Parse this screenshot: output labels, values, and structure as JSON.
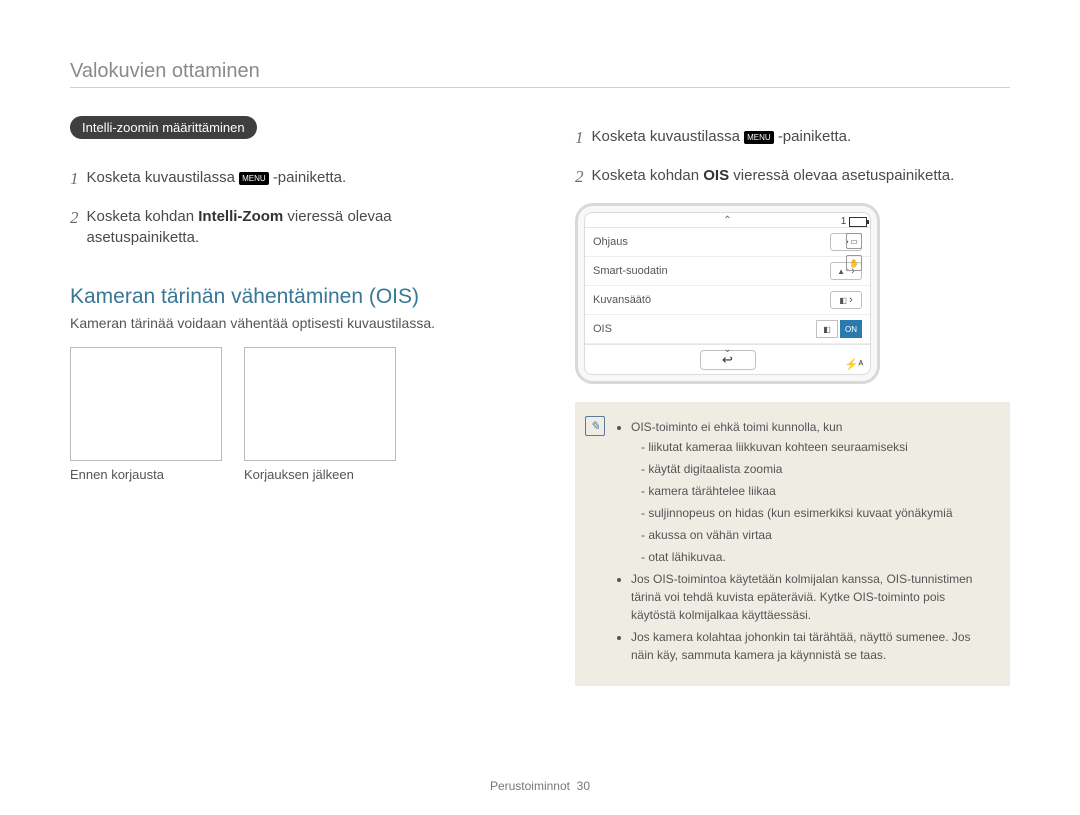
{
  "header": {
    "section_title": "Valokuvien ottaminen"
  },
  "left": {
    "pill": "Intelli-zoomin määrittäminen",
    "step1_prefix": "Kosketa kuvaustilassa ",
    "step1_badge": "MENU",
    "step1_suffix": "-painiketta.",
    "step2_prefix": "Kosketa kohdan ",
    "step2_bold": "Intelli-Zoom",
    "step2_suffix": " vieressä olevaa asetuspainiketta.",
    "heading": "Kameran tärinän vähentäminen (OIS)",
    "subtext": "Kameran tärinää voidaan vähentää optisesti kuvaustilassa.",
    "thumb1_label": "Ennen korjausta",
    "thumb2_label": "Korjauksen jälkeen"
  },
  "right": {
    "step1_prefix": "Kosketa kuvaustilassa ",
    "step1_badge": "MENU",
    "step1_suffix": "-painiketta.",
    "step2_prefix": "Kosketa kohdan ",
    "step2_bold": "OIS",
    "step2_suffix": " vieressä olevaa asetuspainiketta.",
    "screen": {
      "shots": "1",
      "rows": [
        {
          "label": "Ohjaus",
          "control": "chev",
          "icon": ""
        },
        {
          "label": "Smart-suodatin",
          "control": "chev",
          "icon": "▲⁺"
        },
        {
          "label": "Kuvansäätö",
          "control": "chev",
          "icon": "◧"
        },
        {
          "label": "OIS",
          "control": "toggle",
          "left": "◧",
          "right": "ON"
        }
      ],
      "flash": "⚡ᴬ"
    },
    "note": {
      "lead": "OIS-toiminto ei ehkä toimi kunnolla, kun",
      "items": [
        "liikutat kameraa liikkuvan kohteen seuraamiseksi",
        "käytät digitaalista zoomia",
        "kamera tärähtelee liikaa",
        "suljinnopeus on hidas (kun esimerkiksi kuvaat yönäkymiä",
        "akussa on vähän virtaa",
        "otat lähikuvaa."
      ],
      "bullet2": "Jos OIS-toimintoa käytetään kolmijalan kanssa, OIS-tunnistimen tärinä voi tehdä kuvista epäteräviä. Kytke OIS-toiminto pois käytöstä kolmijalkaa käyttäessäsi.",
      "bullet3": "Jos kamera kolahtaa johonkin tai tärähtää, näyttö sumenee. Jos näin käy, sammuta kamera ja käynnistä se taas."
    }
  },
  "footer": {
    "label": "Perustoiminnot",
    "page": "30"
  }
}
